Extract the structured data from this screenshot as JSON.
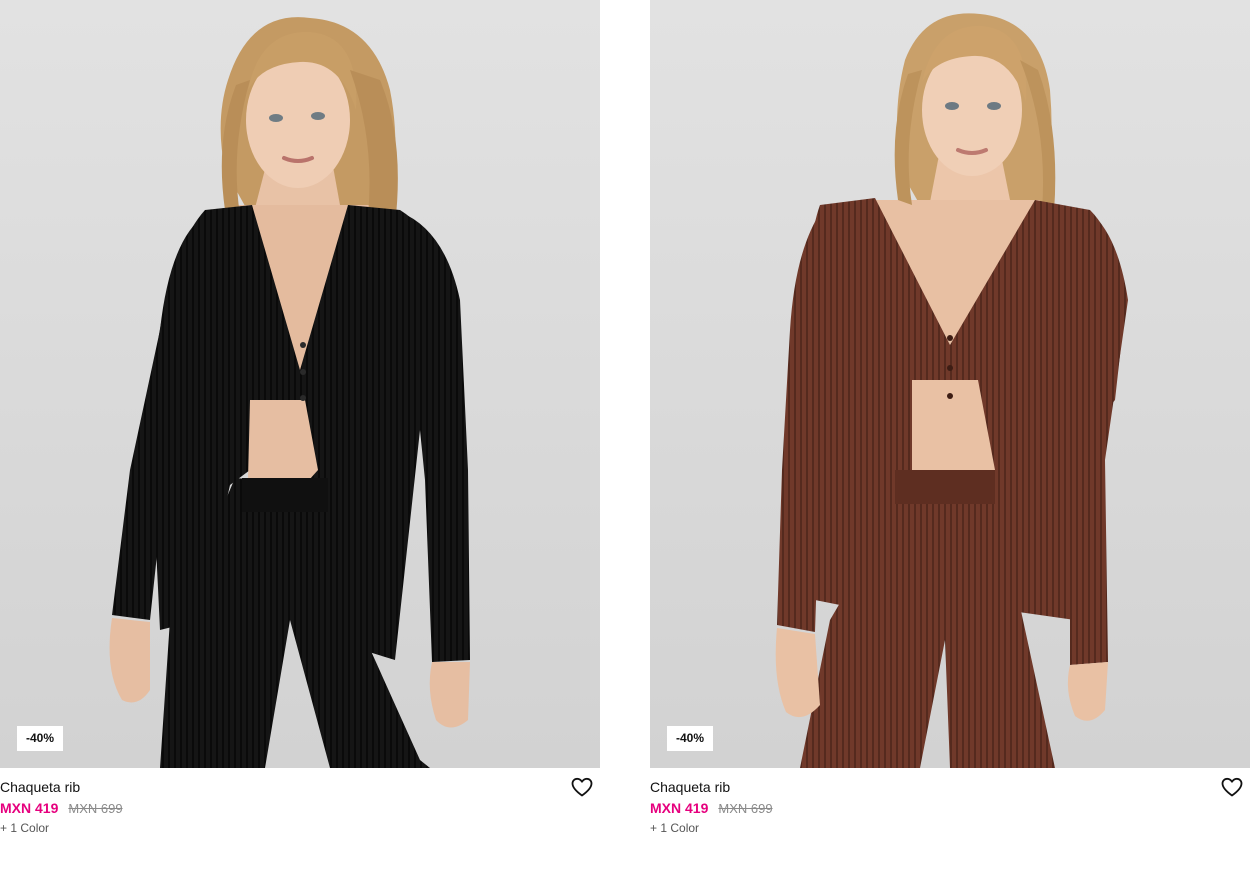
{
  "products": [
    {
      "name": "Chaqueta rib",
      "price": "MXN 419",
      "old_price": "MXN 699",
      "discount_badge": "-40%",
      "colors_more": "+ 1 Color",
      "garment_color": "#121212",
      "favorite_icon": "heart-outline-icon"
    },
    {
      "name": "Chaqueta rib",
      "price": "MXN 419",
      "old_price": "MXN 699",
      "discount_badge": "-40%",
      "colors_more": "+ 1 Color",
      "garment_color": "#6b3526",
      "favorite_icon": "heart-outline-icon"
    }
  ],
  "colors": {
    "sale_price": "#e6007e",
    "old_price": "#8a8a8a",
    "photo_background": "#dcdcdc"
  }
}
